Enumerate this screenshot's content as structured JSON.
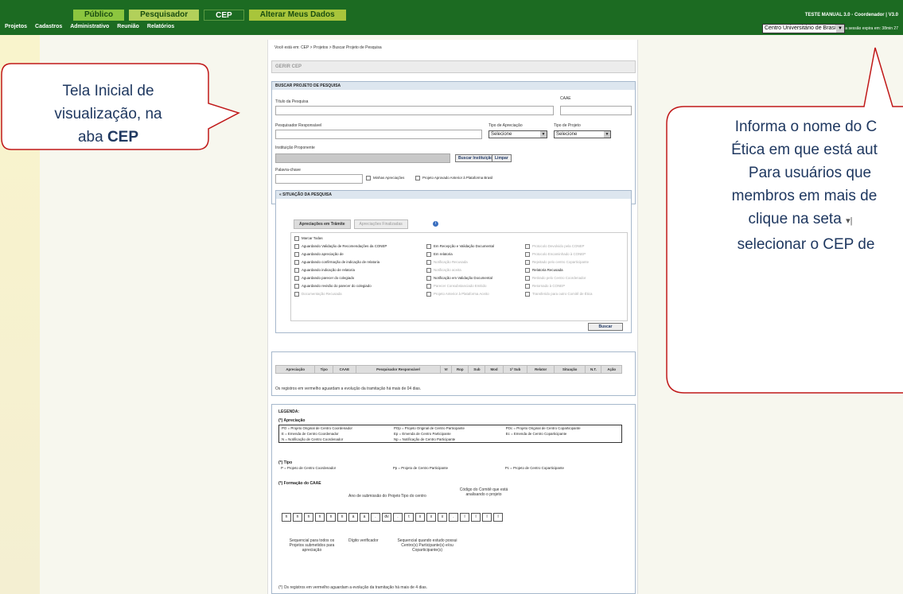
{
  "topbar": {
    "tabs": [
      "Público",
      "Pesquisador",
      "CEP",
      "Alterar Meus Dados"
    ],
    "menu": [
      "Projetos",
      "Cadastros",
      "Administrativo",
      "Reunião",
      "Relatórios"
    ],
    "manual_label": "TESTE MANUAL 3.0 - Coordenador | V3.0",
    "session_text": "Sua sessão expira em: 38min 27",
    "institution_select": "Centro Universitário de Brasí"
  },
  "breadcrumb": "Você está em: CEP > Projetos > Buscar Projeto de Pesquisa",
  "section_title": "GERIR CEP",
  "search": {
    "header": "BUSCAR PROJETO DE PESQUISA",
    "titulo_label": "Título da Pesquisa",
    "caae_label": "CAAE",
    "pesquisador_label": "Pesquisador Responsável",
    "tipo_apreciacao_label": "Tipo de Apreciação",
    "tipo_apreciacao_value": "Selecione",
    "tipo_projeto_label": "Tipo de Projeto",
    "tipo_projeto_value": "Selecione",
    "instituicao_label": "Instituição Proponente",
    "buscar_instituicao": "Buscar Instituição",
    "limpar": "Limpar",
    "palavra_label": "Palavra-chave",
    "minhas_apreciacoes": "Minhas Apreciações",
    "projeto_anterior": "Projeto Aprovado Anterior à Plataforma Brasil"
  },
  "situacao": {
    "header": "SITUAÇÃO DA PESQUISA",
    "collapse_icon": "«",
    "tab_tramite": "Apreciações em Trâmite",
    "tab_finalizadas": "Apreciações Finalizadas",
    "info_glyph": "i",
    "col1": [
      "Marcar Todas",
      "Aguardando Validação de Recomendações da CONEP",
      "Aguardando apreciação de",
      "Aguardando confirmação de indicação de relatoria",
      "Aguardando indicação de relatoria",
      "Aguardando parecer do colegiado",
      "Aguardando revisão do parecer do colegiado",
      "Documentação Recusada"
    ],
    "col2": [
      "Em Recepção e Validação Documental",
      "Em relatoria",
      "Notificação Recusada",
      "Notificação aceita",
      "Notificação em Validação Documental",
      "Parecer Consubstanciado Emitido",
      "Projeto Anterior à Plataforma Aceito"
    ],
    "col3": [
      "Protocolo Devolvido pela CONEP",
      "Protocolo Encaminhado à CONEP",
      "Rejeitado pelo centro Coparticipante",
      "Relatoria Recusada",
      "Retirado pelo Centro Coordenador",
      "Retornado à CONEP",
      "Transferido para outro Comitê de Ética"
    ],
    "buscar": "Buscar"
  },
  "results": {
    "columns": [
      "Apreciação",
      "Tipo",
      "CAAE",
      "Pesquisador Responsável",
      "Vr",
      "Rop",
      "Sub",
      "Mod",
      "1ª Sub",
      "Relator",
      "Situação",
      "N.T.",
      "Ação"
    ],
    "note": "Os registros em vermelho aguardam a evolução da tramitação há mais de 04 dias."
  },
  "legend": {
    "title": "LEGENDA:",
    "apreciacao_title": "(*) Apreciação",
    "apreciacao_rows": [
      [
        "PO = Projeto Original de Centro Coordenador",
        "POp = Projeto Original de Centro Participante",
        "POc = Projeto Original de Centro Coparticipante"
      ],
      [
        "E = Emenda de Centro Coordenador",
        "Ep = Emenda de Centro Participante",
        "Ec = Emenda de Centro Coparticipante"
      ],
      [
        "N = Notificação de Centro Coordenador",
        "Np = Notificação de Centro Participante",
        ""
      ]
    ],
    "tipo_title": "(*) Tipo",
    "tipo_row": [
      "P = Projeto de Centro Coordenador",
      "Pp = Projeto de Centro Participante",
      "Pc = Projeto de Centro Coparticipante"
    ],
    "caae_title": "(*) Formação do CAAE",
    "caae_cells": [
      "n",
      "n",
      "n",
      "n",
      "n",
      "n",
      "a",
      "a",
      ".",
      "dv",
      ".",
      "t",
      "x",
      "x",
      "x",
      ".",
      "l",
      "l",
      "l",
      "l"
    ],
    "ano_label": "Ano de submissão do Projeto",
    "tipo_centro_label": "Tipo do centro",
    "codigo_label": "Código do Comitê que está analisando o projeto",
    "sequencial_label": "Sequencial para todos os Projetos submetidos para apreciação",
    "digito_label": "Dígito verificador",
    "sequencial2_label": "Sequencial quando estudo possui Centro(s) Participante(s) e/ou Coparticipante(s)",
    "note": "(*) Os registros em vermelho aguardam a evolução da tramitação há mais de 4 dias."
  },
  "bubble_left": {
    "line1": "Tela Inicial de",
    "line2": "visualização, na",
    "line3_pre": "aba ",
    "line3_bold": "CEP"
  },
  "bubble_right": {
    "lines": [
      "Informa o nome do C",
      "Ética em que está aut",
      "Para usuários que",
      "membros em mais de",
      "clique na seta",
      "selecionar o CEP de"
    ],
    "arrow_glyph": "▾|"
  },
  "colors": {
    "topbar": "#1c6b22",
    "bubble_border": "#c01818",
    "bubble_text": "#1f3860"
  }
}
